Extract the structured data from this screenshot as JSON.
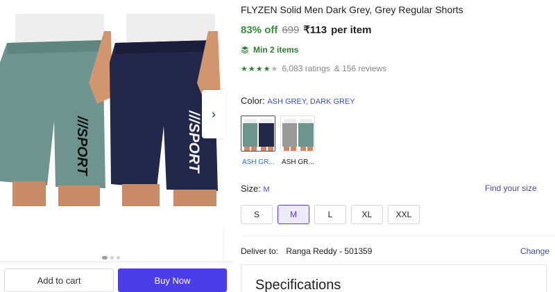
{
  "product": {
    "title": "FLYZEN Solid Men Dark Grey, Grey Regular Shorts",
    "discount": "83% off",
    "mrp": "699",
    "price": "₹113",
    "per_item": "per item",
    "min_items": "Min 2 items",
    "ratings": "6,083 ratings",
    "reviews": "& 156 reviews",
    "rating_value": 4.5
  },
  "gallery": {
    "images": 3,
    "active_index": 0
  },
  "actions": {
    "add_to_cart": "Add to cart",
    "buy_now": "Buy Now"
  },
  "color": {
    "label": "Color:",
    "value": "ASH GREY, DARK GREY",
    "options": [
      {
        "label": "ASH GR...",
        "selected": true
      },
      {
        "label": "ASH GR...",
        "selected": false
      }
    ]
  },
  "size": {
    "label": "Size:",
    "value": "M",
    "guide": "Find your size",
    "options": [
      "S",
      "M",
      "L",
      "XL",
      "XXL"
    ],
    "selected": "M"
  },
  "delivery": {
    "label": "Deliver to:",
    "address": "Ranga Reddy - 501359",
    "change": "Change"
  },
  "specifications": {
    "title": "Specifications"
  },
  "colors": {
    "accent": "#4b3de8",
    "green": "#388e3c",
    "green_dark": "#2e7d32",
    "link": "#3f51b5"
  },
  "icons": [
    "chevron-right-icon",
    "layers-icon",
    "star-icon"
  ]
}
